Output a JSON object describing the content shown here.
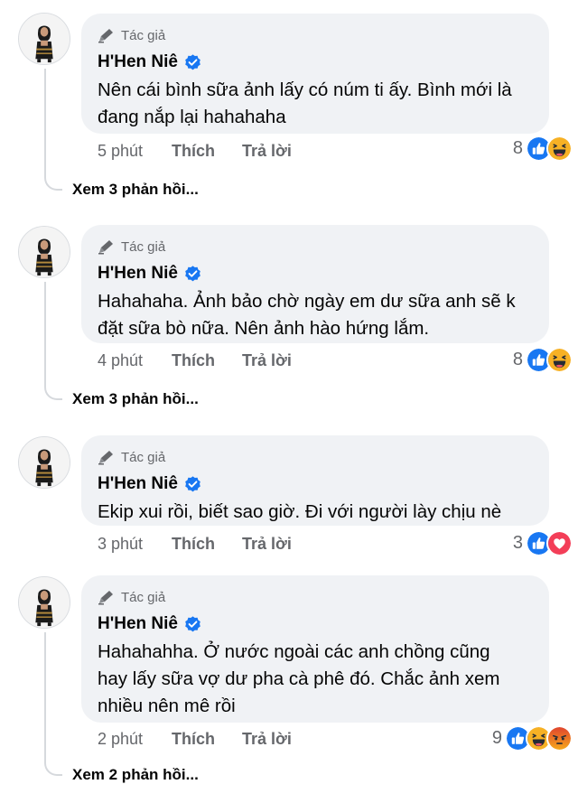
{
  "comments": [
    {
      "badge": "Tác giả",
      "author": "H'Hen Niê",
      "text": "Nên cái bình sữa ảnh lấy có núm ti ấy. Bình mới là\nđang nắp lại hahahaha",
      "time": "5 phút",
      "like": "Thích",
      "reply": "Trả lời",
      "reaction_count": "8",
      "reactions": [
        "like-icon",
        "haha-icon"
      ],
      "view_replies": "Xem 3 phản hồi..."
    },
    {
      "badge": "Tác giả",
      "author": "H'Hen Niê",
      "text": "Hahahaha. Ảnh bảo chờ ngày em dư sữa anh sẽ k\nđặt sữa bò nữa. Nên ảnh hào hứng lắm.",
      "time": "4 phút",
      "like": "Thích",
      "reply": "Trả lời",
      "reaction_count": "8",
      "reactions": [
        "like-icon",
        "haha-icon"
      ],
      "view_replies": "Xem 3 phản hồi..."
    },
    {
      "badge": "Tác giả",
      "author": "H'Hen Niê",
      "text": "Ekip xui rồi, biết sao giờ. Đi với người lày chịu nè",
      "time": "3 phút",
      "like": "Thích",
      "reply": "Trả lời",
      "reaction_count": "3",
      "reactions": [
        "like-icon",
        "love-icon"
      ]
    },
    {
      "badge": "Tác giả",
      "author": "H'Hen Niê",
      "text": "Hahahahha. Ở nước ngoài các anh chồng cũng\nhay lấy sữa vợ dư pha cà phê đó. Chắc ảnh xem\nnhiều nên mê rồi",
      "time": "2 phút",
      "like": "Thích",
      "reply": "Trả lời",
      "reaction_count": "9",
      "reactions": [
        "like-icon",
        "haha-icon",
        "angry-icon"
      ],
      "view_replies": "Xem 2 phản hồi..."
    }
  ],
  "colors": {
    "bubble": "#f0f2f5",
    "secondary_text": "#65676b",
    "verified_blue": "#1877f2",
    "like_blue": "#1877f2",
    "haha_yellow": "#f7b125",
    "love_red": "#f33e58",
    "angry_orange": "#e9710f"
  }
}
